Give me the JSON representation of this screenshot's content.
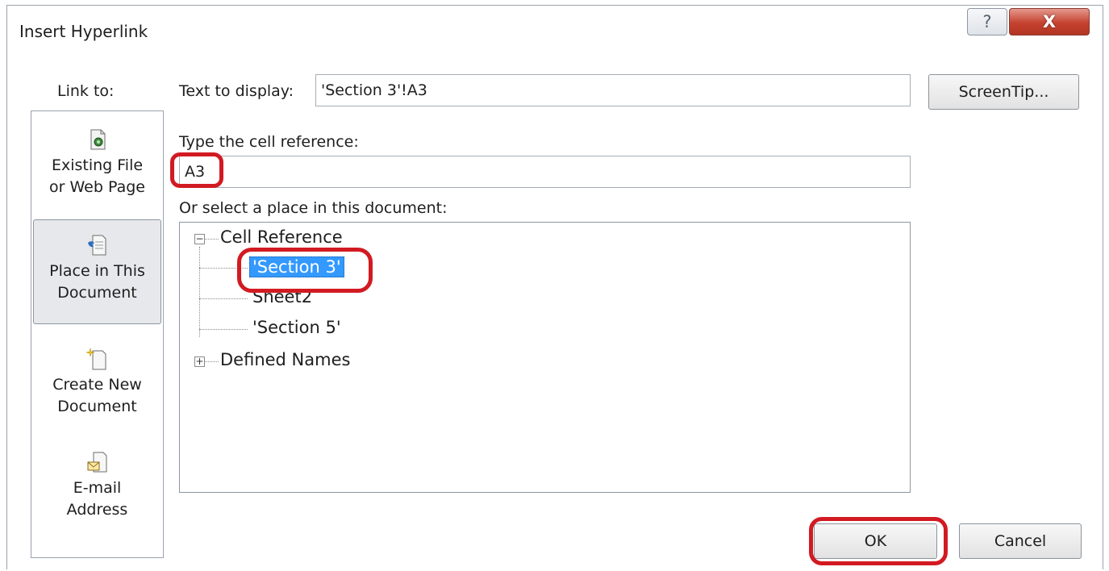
{
  "window": {
    "title": "Insert Hyperlink",
    "help_glyph": "?",
    "close_glyph": "X"
  },
  "link_to": {
    "label": "Link to:",
    "items": [
      {
        "line1": "Existing File",
        "line2": "or Web Page",
        "icon": "existing-file-icon",
        "selected": false
      },
      {
        "line1": "Place in This",
        "line2": "Document",
        "icon": "place-in-document-icon",
        "selected": true
      },
      {
        "line1": "Create New",
        "line2": "Document",
        "icon": "new-document-icon",
        "selected": false
      },
      {
        "line1": "E-mail",
        "line2": "Address",
        "icon": "email-icon",
        "selected": false
      }
    ]
  },
  "text_to_display": {
    "label": "Text to display:",
    "value": "'Section 3'!A3"
  },
  "screentip_button": "ScreenTip...",
  "cell_reference": {
    "label": "Type the cell reference:",
    "value": "A3"
  },
  "place_select": {
    "label": "Or select a place in this document:",
    "tree": {
      "root": {
        "label": "Cell Reference",
        "expander": "−"
      },
      "children": [
        "'Section 3'",
        "Sheet2",
        "'Section 5'"
      ],
      "selected": "'Section 3'",
      "defined_names": {
        "label": "Defined Names",
        "expander": "+"
      }
    }
  },
  "buttons": {
    "ok": "OK",
    "cancel": "Cancel"
  },
  "colors": {
    "annotation_red": "#d21a22",
    "selection_blue": "#3399ff",
    "close_red": "#c4422f"
  }
}
